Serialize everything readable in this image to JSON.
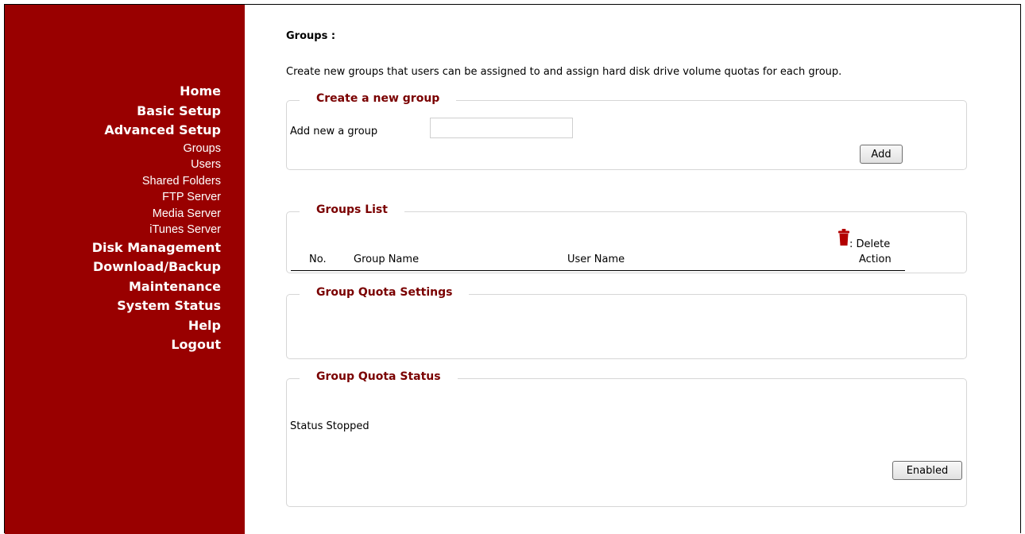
{
  "sidebar": {
    "main_top": [
      "Home",
      "Basic Setup",
      "Advanced Setup"
    ],
    "sub": [
      "Groups",
      "Users",
      "Shared Folders",
      "FTP Server",
      "Media Server",
      "iTunes Server"
    ],
    "main_bottom": [
      "Disk Management",
      "Download/Backup",
      "Maintenance",
      "System Status",
      "Help",
      "Logout"
    ]
  },
  "page": {
    "title": "Groups :",
    "description": "Create new groups that users can be assigned to and assign hard disk drive volume quotas for each group."
  },
  "create_group": {
    "legend": "Create a new group",
    "label": "Add new a group",
    "input_value": "",
    "add_label": "Add"
  },
  "groups_list": {
    "legend": "Groups List",
    "columns": {
      "no": "No.",
      "group_name": "Group Name",
      "user_name": "User Name",
      "delete": ": Delete",
      "action": "Action"
    },
    "icon": "trash-icon",
    "rows": []
  },
  "quota_settings": {
    "legend": "Group Quota Settings"
  },
  "quota_status": {
    "legend": "Group Quota Status",
    "status_text": "Status Stopped",
    "enable_label": "Enabled"
  },
  "colors": {
    "sidebar_bg": "#990000",
    "legend_text": "#7a0000",
    "trash_icon": "#b30000"
  }
}
